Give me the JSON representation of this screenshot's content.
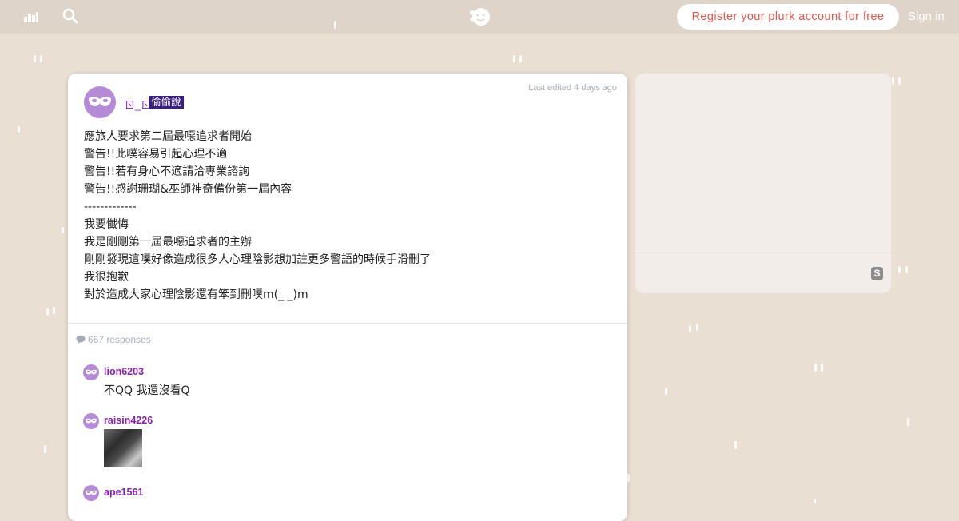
{
  "header": {
    "register_label": "Register your plurk account for free",
    "signin_label": "Sign in",
    "icons": [
      "stats-icon",
      "search-icon",
      "plurk-logo-icon"
    ]
  },
  "plurk": {
    "author": "ㄖ_ㄖ",
    "qualifier": "偷偷說",
    "edited": "Last edited 4 days ago",
    "content_lines": [
      "應旅人要求第二屆最噁追求者開始",
      "警告!!此噗容易引起心理不適",
      "警告!!若有身心不適請洽專業諮詢",
      "警告!!感謝珊瑚&巫師神奇備份第一屆內容",
      "-------------",
      "我要懺悔",
      "我是剛剛第一屆最噁追求者的主辦",
      "剛剛發現這噗好像造成很多人心理陰影想加註更多警語的時候手滑刪了",
      "我很抱歉",
      "對於造成大家心理陰影還有笨到刪噗m(_ _)m"
    ],
    "response_count": "667 responses"
  },
  "responses": [
    {
      "name": "lion6203",
      "text": "不QQ 我還沒看Q"
    },
    {
      "name": "raisin4226",
      "text": ""
    },
    {
      "name": "ape1561",
      "text": ""
    }
  ],
  "side": {
    "badge": "S"
  },
  "colors": {
    "background": "#eadfd3",
    "topbar": "#dfd4c9",
    "register_text": "#e0574e",
    "username": "#8b1fad",
    "qualifier_bg": "#3a1f7b",
    "avatar": "#b58ad6"
  }
}
